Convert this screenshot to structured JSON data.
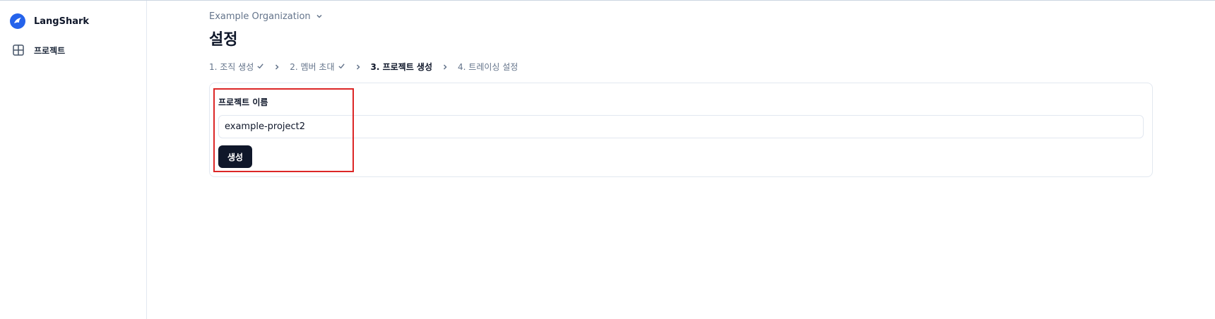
{
  "sidebar": {
    "brand": "LangShark",
    "items": [
      {
        "label": "프로젝트",
        "icon": "grid-icon"
      }
    ]
  },
  "header": {
    "organization": "Example Organization",
    "title": "설정"
  },
  "steps": [
    {
      "label": "1. 조직 생성",
      "done": true
    },
    {
      "label": "2. 멤버 초대",
      "done": true
    },
    {
      "label": "3. 프로젝트 생성",
      "active": true
    },
    {
      "label": "4. 트레이싱 설정"
    }
  ],
  "form": {
    "label": "프로젝트 이름",
    "value": "example-project2",
    "submit_label": "생성"
  },
  "colors": {
    "brand": "#2563eb",
    "primary_button": "#0f172a",
    "highlight": "#dc2626"
  }
}
